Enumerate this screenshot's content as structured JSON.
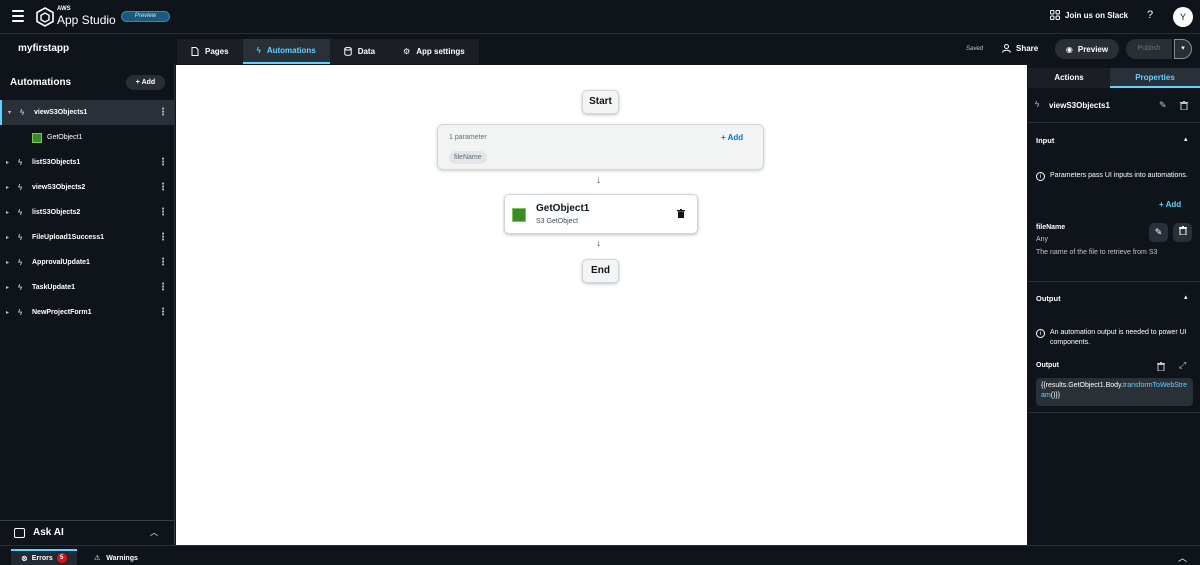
{
  "topbar": {
    "brand_small": "AWS",
    "brand": "App Studio",
    "preview_badge": "Preview",
    "slack": "Join us on Slack",
    "help": "?",
    "avatar_initial": "Y"
  },
  "appbar": {
    "app_name": "myfirstapp",
    "tabs": [
      {
        "label": "Pages",
        "icon": "page-icon"
      },
      {
        "label": "Automations",
        "icon": "bolt-icon",
        "active": true
      },
      {
        "label": "Data",
        "icon": "database-icon"
      },
      {
        "label": "App settings",
        "icon": "gear-icon"
      }
    ],
    "saved": "Saved",
    "share": "Share",
    "preview": "Preview",
    "publish": "Publish"
  },
  "sidebar": {
    "title": "Automations",
    "add_label": "Add",
    "items": [
      {
        "label": "viewS3Objects1",
        "expanded": true,
        "selected": true
      },
      {
        "label": "GetObject1",
        "child": true
      },
      {
        "label": "listS3Objects1"
      },
      {
        "label": "viewS3Objects2"
      },
      {
        "label": "listS3Objects2"
      },
      {
        "label": "FileUpload1Success1"
      },
      {
        "label": "ApprovalUpdate1"
      },
      {
        "label": "TaskUpdate1"
      },
      {
        "label": "NewProjectForm1"
      }
    ],
    "ask_ai": "Ask AI"
  },
  "canvas": {
    "start": "Start",
    "end": "End",
    "param_count": "1 parameter",
    "param_add": "Add",
    "param_chip": "fileName",
    "step_title": "GetObject1",
    "step_subtitle": "S3 GetObject"
  },
  "right_panel": {
    "tabs": [
      "Actions",
      "Properties"
    ],
    "active_tab": "Properties",
    "automation_name": "viewS3Objects1",
    "input_heading": "Input",
    "input_info": "Parameters pass UI inputs into automations.",
    "input_add": "Add",
    "param": {
      "name": "fileName",
      "type": "Any",
      "description": "The name of the file to retrieve from S3"
    },
    "output_heading": "Output",
    "output_info": "An automation output is needed to power UI components.",
    "output_label": "Output",
    "output_code_prefix": "{{results.GetObject1.Body.",
    "output_code_method": "transformToWebStream",
    "output_code_suffix": "()}}"
  },
  "bottombar": {
    "errors_label": "Errors",
    "errors_count": "5",
    "warnings_label": "Warnings"
  },
  "colors": {
    "accent": "#5fd2ff",
    "link_blue": "#0972d3",
    "error_red": "#d91515",
    "dark_bg": "#0f141a"
  }
}
